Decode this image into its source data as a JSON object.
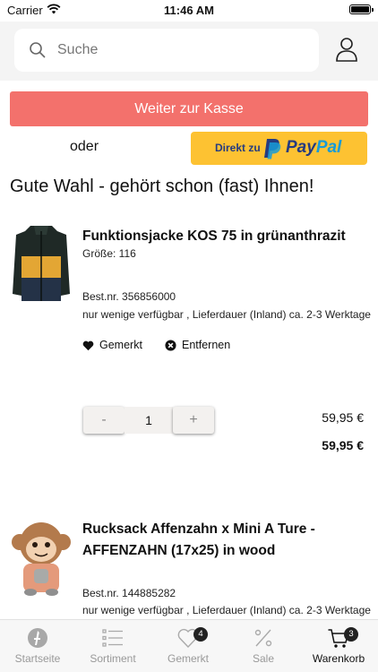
{
  "status_bar": {
    "carrier": "Carrier",
    "time": "11:46 AM"
  },
  "search": {
    "placeholder": "Suche"
  },
  "checkout": {
    "button_label": "Weiter zur Kasse",
    "or_label": "oder",
    "paypal_prefix": "Direkt zu",
    "paypal_pay": "Pay",
    "paypal_pal": "Pal"
  },
  "headline": "Gute Wahl - gehört schon (fast) Ihnen!",
  "products": [
    {
      "title": "Funktionsjacke KOS 75 in grünanthrazit",
      "size": "Größe: 116",
      "order_no": "Best.nr. 356856000",
      "availability": "nur wenige verfügbar , Lieferdauer (Inland) ca. 2-3 Werktage",
      "favorite_label": "Gemerkt",
      "remove_label": "Entfernen",
      "quantity": "1",
      "minus_label": "-",
      "plus_label": "+",
      "unit_price": "59,95 €",
      "total_price": "59,95 €"
    },
    {
      "title": "Rucksack Affenzahn x Mini A Ture - AFFENZAHN (17x25) in wood",
      "order_no": "Best.nr. 144885282",
      "availability": "nur wenige verfügbar , Lieferdauer (Inland) ca. 2-3 Werktage"
    }
  ],
  "tabbar": {
    "items": [
      {
        "label": "Startseite",
        "icon": "home-icon"
      },
      {
        "label": "Sortiment",
        "icon": "list-icon"
      },
      {
        "label": "Gemerkt",
        "icon": "heart-icon",
        "badge": "4"
      },
      {
        "label": "Sale",
        "icon": "percent-icon"
      },
      {
        "label": "Warenkorb",
        "icon": "cart-icon",
        "badge": "3",
        "active": true
      }
    ]
  },
  "colors": {
    "checkout": "#f3716c",
    "paypal_bg": "#fdc232",
    "paypal_dark": "#253b80",
    "paypal_light": "#179bd7",
    "header_bg": "#f4f4f4"
  }
}
